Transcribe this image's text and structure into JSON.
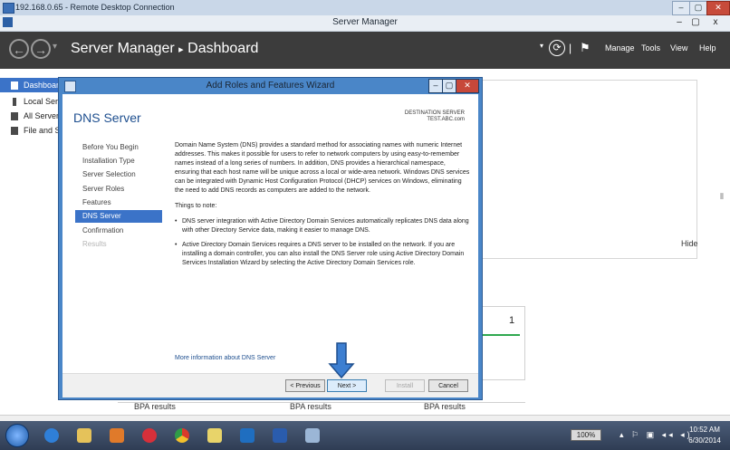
{
  "rdp": {
    "title": "192.168.0.65 - Remote Desktop Connection",
    "minimize": "–",
    "restore": "▢",
    "close": "✕"
  },
  "window": {
    "title": "Server Manager",
    "minimize": "–",
    "maximize": "▢",
    "close": "x"
  },
  "header": {
    "breadcrumb_app": "Server Manager",
    "breadcrumb_sep": "▸",
    "breadcrumb_page": "Dashboard",
    "menu": [
      "Manage",
      "Tools",
      "View",
      "Help"
    ],
    "refresh_icon": "⟳",
    "divider": "|",
    "flag_icon": "⚑",
    "dropdown_arrow": "▾"
  },
  "sidebar": {
    "items": [
      {
        "label": "Dashboard",
        "icon": "dashboard-icon",
        "active": true
      },
      {
        "label": "Local Server",
        "icon": "server-icon",
        "active": false
      },
      {
        "label": "All Servers",
        "icon": "servers-icon",
        "active": false
      },
      {
        "label": "File and Storage Services",
        "icon": "storage-icon",
        "active": false
      }
    ]
  },
  "dashboard": {
    "hide_label": "Hide",
    "tile_count": "1",
    "bpa": [
      "BPA results",
      "BPA results",
      "BPA results"
    ],
    "scroll_marks": "⦀"
  },
  "wizard": {
    "title": "Add Roles and Features Wizard",
    "heading": "DNS Server",
    "destination_label": "DESTINATION SERVER",
    "destination_value": "TEST.ABC.com",
    "nav": [
      {
        "label": "Before You Begin",
        "state": "normal"
      },
      {
        "label": "Installation Type",
        "state": "normal"
      },
      {
        "label": "Server Selection",
        "state": "normal"
      },
      {
        "label": "Server Roles",
        "state": "normal"
      },
      {
        "label": "Features",
        "state": "normal"
      },
      {
        "label": "DNS Server",
        "state": "active"
      },
      {
        "label": "Confirmation",
        "state": "normal"
      },
      {
        "label": "Results",
        "state": "disabled"
      }
    ],
    "intro": "Domain Name System (DNS) provides a standard method for associating names with numeric Internet addresses. This makes it possible for users to refer to network computers by using easy-to-remember names instead of a long series of numbers. In addition, DNS provides a hierarchical namespace, ensuring that each host name will be unique across a local or wide-area network. Windows DNS services can be integrated with Dynamic Host Configuration Protocol (DHCP) services on Windows, eliminating the need to add DNS records as computers are added to the network.",
    "things_label": "Things to note:",
    "bullets": [
      "DNS server integration with Active Directory Domain Services automatically replicates DNS data along with other Directory Service data, making it easier to manage DNS.",
      "Active Directory Domain Services requires a DNS server to be installed on the network. If you are installing a domain controller, you can also install the DNS Server role using Active Directory Domain Services Installation Wizard by selecting the Active Directory Domain Services role."
    ],
    "bullet_char": "•",
    "more_link": "More information about DNS Server",
    "buttons": {
      "previous": "< Previous",
      "next": "Next >",
      "install": "Install",
      "cancel": "Cancel"
    },
    "title_minimize": "–",
    "title_maximize": "▢",
    "title_close": "✕"
  },
  "taskbar": {
    "apps": [
      "internet-explorer",
      "file-explorer",
      "media-player",
      "iTunes",
      "chrome",
      "notes",
      "outlook",
      "word",
      "remote-desktop"
    ],
    "zoom": "100%",
    "tray": "▴ ⚐ ▣ ◂◂ ◂)",
    "time": "10:52 AM",
    "date": "6/30/2014"
  },
  "colors": {
    "header_bg": "#3c3c3c",
    "accent": "#3b73c8",
    "wizard_frame": "#4a86c8",
    "tile_line": "#2fa84f",
    "arrow": "#3d7fd1"
  }
}
